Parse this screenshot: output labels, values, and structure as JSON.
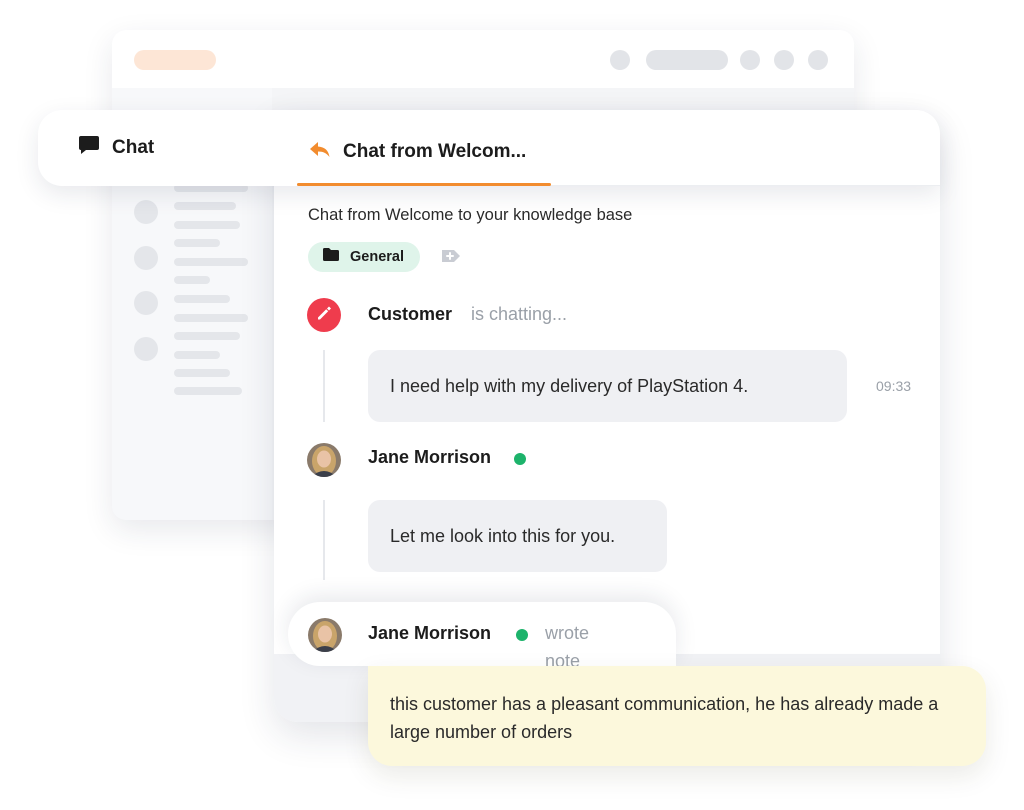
{
  "tabs": {
    "chat_label": "Chat",
    "active_label": "Chat from Welcom..."
  },
  "conversation": {
    "subject": "Chat from Welcome to your knowledge base",
    "tag": "General"
  },
  "messages": [
    {
      "sender": "Customer",
      "status": "is chatting...",
      "text": "I need help with my delivery of PlayStation 4.",
      "time": "09:33"
    },
    {
      "sender": "Jane Morrison",
      "online": true,
      "text": "Let me look into this for you."
    }
  ],
  "note": {
    "sender": "Jane Morrison",
    "action_line1": "wrote",
    "action_line2": "note",
    "text": "this customer has a pleasant communication, he has already made a large number of orders"
  },
  "colors": {
    "accent": "#f28c2e",
    "online": "#1db36b",
    "edit_avatar": "#ef3c4d",
    "tag_bg": "#dff4ea",
    "note_bg": "#fcf8dc"
  },
  "icons": {
    "chat_tab": "chat-bubble-icon",
    "active_tab": "reply-arrow-icon",
    "tag": "folder-icon",
    "add_tag": "add-tag-icon",
    "customer_avatar": "pencil-icon"
  }
}
